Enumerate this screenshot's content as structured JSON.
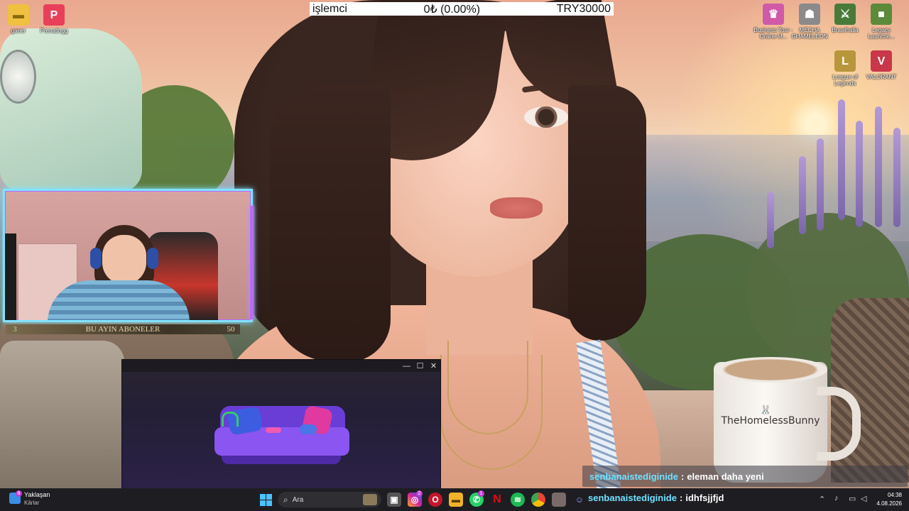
{
  "ticker": {
    "label": "işlemci",
    "change": "0₺ (0.00%)",
    "price": "TRY30000"
  },
  "desktop_icons_left": [
    {
      "label": "ganer",
      "color": "#f0c040",
      "glyph": "▬",
      "icon": "folder-icon"
    },
    {
      "label": "Prenatlogg",
      "color": "#e8405a",
      "glyph": "P",
      "icon": "prenatlogg-icon"
    }
  ],
  "desktop_icons_right": [
    {
      "label": "Business Tour - Online M...",
      "color": "#d05aa8",
      "glyph": "♛",
      "icon": "business-tour-icon"
    },
    {
      "label": "MECHA GHAMELEON",
      "color": "#8a8a8a",
      "glyph": "☗",
      "icon": "mecha-icon"
    },
    {
      "label": "Brawlhalla",
      "color": "#4a7a3a",
      "glyph": "⚔",
      "icon": "brawlhalla-icon"
    },
    {
      "label": "Legacy Launche...",
      "color": "#5a8a3a",
      "glyph": "■",
      "icon": "minecraft-icon"
    },
    {
      "label": "League of Legends",
      "color": "#b8963c",
      "glyph": "L",
      "icon": "league-of-legends-icon"
    },
    {
      "label": "VALORANT",
      "color": "#c8374a",
      "glyph": "V",
      "icon": "valorant-icon"
    }
  ],
  "webcam": {
    "bar_left": "3",
    "bar_title": "BU AYIN ABONELER",
    "bar_right": "50"
  },
  "mug": {
    "text": "TheHomelessBunny",
    "glyph": "🐰"
  },
  "chat_overlay": {
    "user": "senbanaistediginide",
    "separator": ":",
    "message": "eleman daha yeni"
  },
  "taskbar": {
    "weather_title": "Yaklaşan",
    "weather_sub": "Kârlar",
    "search_placeholder": "Ara",
    "chat_user": "senbanaistediginide",
    "chat_separator": ":",
    "chat_message": "idhfsjjfjd",
    "time": "04:38",
    "date": "4.08.2026",
    "badge_weather": "8",
    "badge_instagram": "2",
    "badge_whatsapp": "1"
  },
  "window": {
    "minimize": "—",
    "maximize": "☐",
    "close": "✕"
  }
}
